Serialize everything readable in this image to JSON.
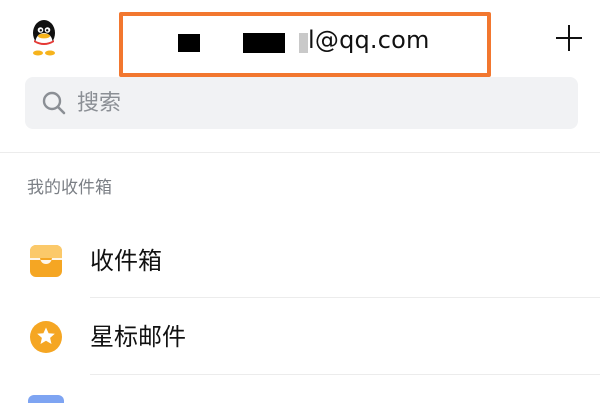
{
  "header": {
    "account_email": "l@qq.com"
  },
  "search": {
    "placeholder": "搜索"
  },
  "section": {
    "title": "我的收件箱"
  },
  "list": {
    "items": [
      {
        "label": "收件箱",
        "icon": "inbox-icon",
        "color": "#f5a623"
      },
      {
        "label": "星标邮件",
        "icon": "star-icon",
        "color": "#f5a623"
      }
    ]
  },
  "colors": {
    "highlight": "#f2772f",
    "accent": "#f5a623",
    "partial_icon": "#7ea4f2"
  }
}
